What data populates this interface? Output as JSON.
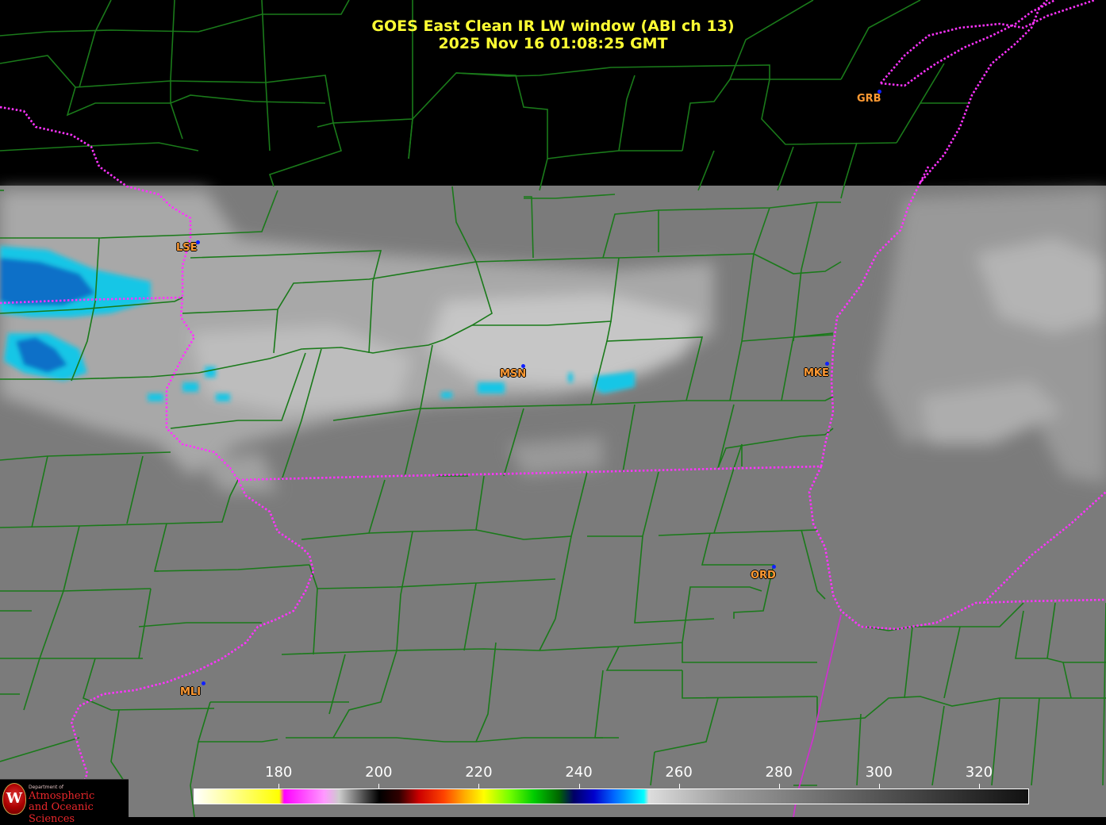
{
  "header": {
    "title_line1": "GOES East Clean IR LW window (ABI ch 13)",
    "title_line2": "2025 Nov 16  01:08:25 GMT"
  },
  "cities": [
    {
      "code": "GRB",
      "color": "#ff9a33"
    },
    {
      "code": "LSE",
      "color": "#ff9a33"
    },
    {
      "code": "MSN",
      "color": "#ff9a33"
    },
    {
      "code": "MKE",
      "color": "#ff9a33"
    },
    {
      "code": "ORD",
      "color": "#ff9a33"
    },
    {
      "code": "MLI",
      "color": "#ff9a33"
    }
  ],
  "colorbar": {
    "ticks": [
      "180",
      "200",
      "220",
      "240",
      "260",
      "280",
      "300",
      "320"
    ],
    "min": 163,
    "max": 330
  },
  "logo": {
    "small": "Department of",
    "line1": "Atmospheric",
    "line2": "and Oceanic Sciences",
    "seal": "W"
  },
  "colors": {
    "title": "#ffff33",
    "county_lines": "#1a7a1a",
    "state_lines": "#ff33ff",
    "city_dot": "#1020ff",
    "background": "#000000"
  }
}
